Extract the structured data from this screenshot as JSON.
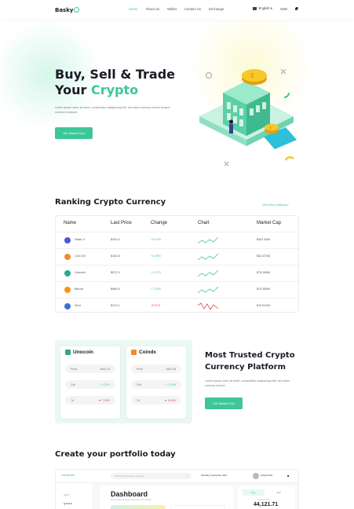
{
  "header": {
    "logo": "Basky",
    "nav": [
      "Home",
      "About Us",
      "Wallet",
      "Contact Us",
      "Exchange"
    ],
    "language": "English",
    "currency": "USD"
  },
  "hero": {
    "title_line1": "Buy, Sell & Trade",
    "title_line2_plain": "Your ",
    "title_line2_accent": "Crypto",
    "description": "Lorem ipsum dolor sit amet, consectetur sadipscing elitr, sed diam nonumy eirmod tempor invidunt ut labore.",
    "cta": "Get Started Tool"
  },
  "ranking": {
    "title": "Ranking Crypto Currency",
    "view_more": "View More Markets",
    "columns": [
      "Name",
      "Last Price",
      "Change",
      "Chart",
      "Market Cap"
    ],
    "rows": [
      {
        "name": "Wazir X",
        "price": "$320.4",
        "change": "+5.20%",
        "cap": "$457.60M",
        "icon_color": "#4b5bd8",
        "trend": "up"
      },
      {
        "name": "Coin DX",
        "price": "$160.6",
        "change": "+5.35%",
        "cap": "$32,370M",
        "icon_color": "#f28a2e",
        "trend": "up"
      },
      {
        "name": "Unocoin",
        "price": "$572.3",
        "change": "+1.27%",
        "cap": "$75,280M",
        "icon_color": "#2aa98b",
        "trend": "up"
      },
      {
        "name": "Bitcoin",
        "price": "$986.9",
        "change": "+7.35%",
        "cap": "$75,380M",
        "icon_color": "#f7931a",
        "trend": "up"
      },
      {
        "name": "Zera",
        "price": "$170.1",
        "change": "-5.37%",
        "cap": "$10,510M",
        "icon_color": "#3b6fd8",
        "trend": "down"
      }
    ]
  },
  "cards": [
    {
      "name": "Unocoin",
      "icon_color": "#2aa98b",
      "price_label": "Price",
      "price": "1800.10",
      "day_label": "24h",
      "day": "+ 3.21%",
      "week_label": "7d",
      "week": "▼ 7.03%"
    },
    {
      "name": "Coindx",
      "icon_color": "#f28a2e",
      "price_label": "Price",
      "price": "1800.26",
      "day_label": "24h",
      "day": "+ 7.13%",
      "week_label": "7d",
      "week": "▼ 9.23%"
    }
  ],
  "trusted": {
    "title": "Most Trusted Crypto Currency Platform",
    "description": "Lorem ipsum dolor sit amet, consectetur sadipscing elitr, sed diam nonumy eirmod.",
    "cta": "Get Started Tool"
  },
  "portfolio": {
    "title": "Create your portfolio today",
    "dashboard_logo": "UNI CRYPTO",
    "search_placeholder": "Search cryptocurrency, name etc.",
    "date": "Saturday, 8 september, 2021",
    "user": "Ashiqul Kabir",
    "menu_label": "MENU",
    "menu_item": "Market",
    "dashboard_title": "Dashboard",
    "dashboard_subtitle": "An overview of cryptocurrencies and markets",
    "tab_buy": "Buy",
    "tab_sell": "Sell",
    "balance_label": "Account price",
    "balance": "44,121.71"
  }
}
